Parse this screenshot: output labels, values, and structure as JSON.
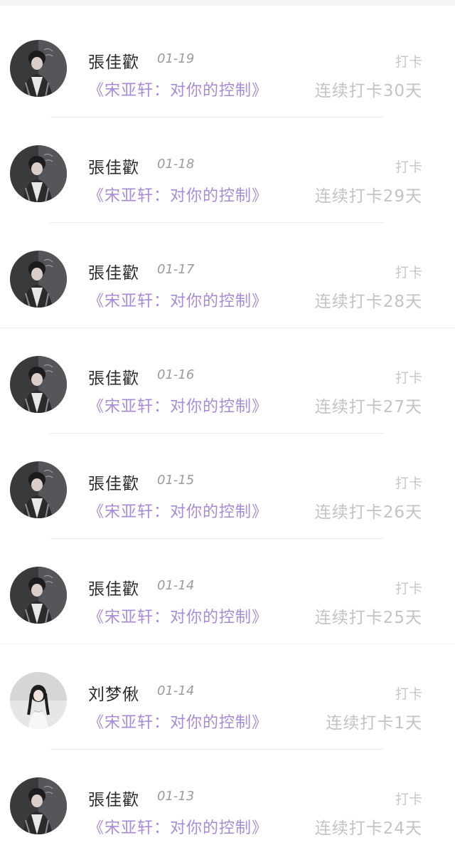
{
  "feed": {
    "items": [
      {
        "name": "張佳歡",
        "date": "01-19",
        "tag": "打卡",
        "title": "《宋亚轩：对你的控制》",
        "streak": "连续打卡30天",
        "avatar": "boy-avatar"
      },
      {
        "name": "張佳歡",
        "date": "01-18",
        "tag": "打卡",
        "title": "《宋亚轩：对你的控制》",
        "streak": "连续打卡29天",
        "avatar": "boy-avatar"
      },
      {
        "name": "張佳歡",
        "date": "01-17",
        "tag": "打卡",
        "title": "《宋亚轩：对你的控制》",
        "streak": "连续打卡28天",
        "avatar": "boy-avatar"
      },
      {
        "name": "張佳歡",
        "date": "01-16",
        "tag": "打卡",
        "title": "《宋亚轩：对你的控制》",
        "streak": "连续打卡27天",
        "avatar": "boy-avatar"
      },
      {
        "name": "張佳歡",
        "date": "01-15",
        "tag": "打卡",
        "title": "《宋亚轩：对你的控制》",
        "streak": "连续打卡26天",
        "avatar": "boy-avatar"
      },
      {
        "name": "張佳歡",
        "date": "01-14",
        "tag": "打卡",
        "title": "《宋亚轩：对你的控制》",
        "streak": "连续打卡25天",
        "avatar": "boy-avatar"
      },
      {
        "name": "刘梦偢",
        "date": "01-14",
        "tag": "打卡",
        "title": "《宋亚轩：对你的控制》",
        "streak": "连续打卡1天",
        "avatar": "girl-avatar"
      },
      {
        "name": "張佳歡",
        "date": "01-13",
        "tag": "打卡",
        "title": "《宋亚轩：对你的控制》",
        "streak": "连续打卡24天",
        "avatar": "boy-avatar"
      }
    ]
  },
  "colors": {
    "title_purple": "#a88ad6",
    "muted_gray": "#c3c3c3",
    "name_dark": "#2a2a2a"
  }
}
